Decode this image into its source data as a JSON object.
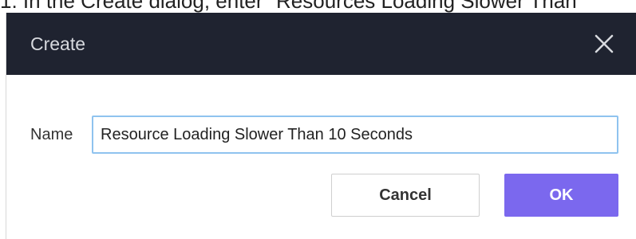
{
  "caption": "1. In the Create dialog, enter \"Resources Loading Slower Than",
  "dialog": {
    "title": "Create",
    "close_icon": "close-icon",
    "field": {
      "label": "Name",
      "value": "Resource Loading Slower Than 10 Seconds"
    },
    "buttons": {
      "cancel_label": "Cancel",
      "ok_label": "OK"
    }
  },
  "colors": {
    "header_bg": "#1f2330",
    "primary_button": "#7b68ee",
    "input_focus_border": "#8fc3ef"
  }
}
